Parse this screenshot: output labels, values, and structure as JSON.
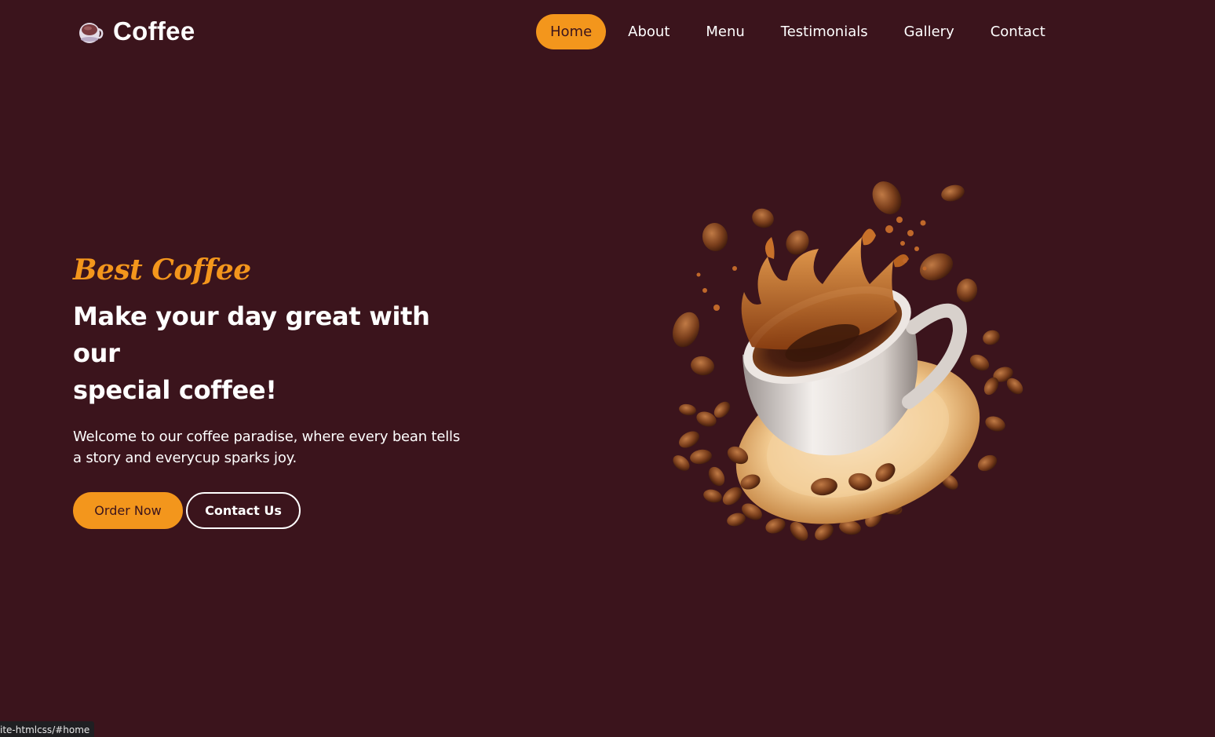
{
  "brand": {
    "name": "Coffee",
    "icon": "coffee-cup-icon"
  },
  "nav": {
    "items": [
      {
        "label": "Home",
        "active": true
      },
      {
        "label": "About",
        "active": false
      },
      {
        "label": "Menu",
        "active": false
      },
      {
        "label": "Testimonials",
        "active": false
      },
      {
        "label": "Gallery",
        "active": false
      },
      {
        "label": "Contact",
        "active": false
      }
    ]
  },
  "hero": {
    "subtitle": "Best Coffee",
    "title_line1": "Make your day great with our",
    "title_line2": "special coffee!",
    "description_line1": "Welcome to our coffee paradise, where every bean tells",
    "description_line2": "a story and everycup sparks joy.",
    "order_label": "Order Now",
    "contact_label": "Contact Us",
    "image": "coffee-cup-splash-with-beans"
  },
  "status_bar": {
    "url": "ite-htmlcss/#home"
  },
  "colors": {
    "background": "#3b141c",
    "accent": "#f3961c",
    "text": "#ffffff"
  }
}
